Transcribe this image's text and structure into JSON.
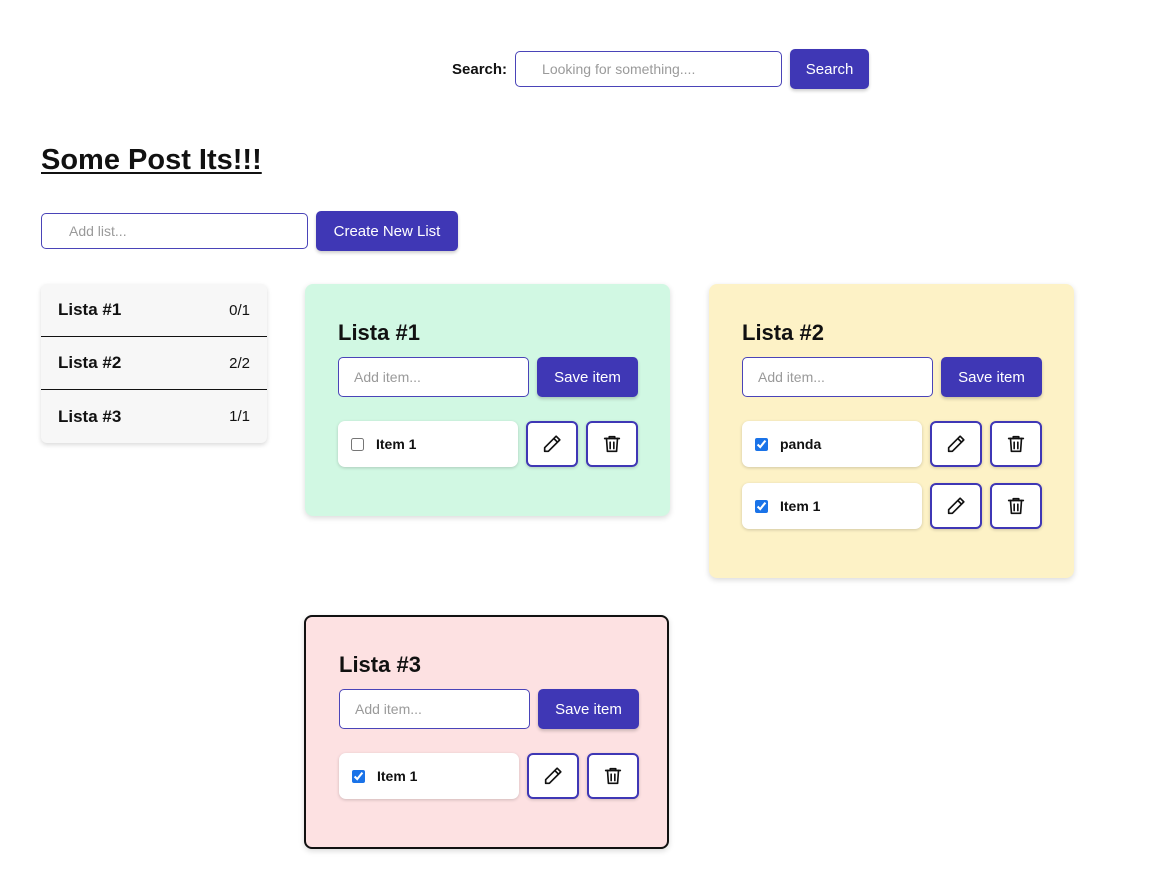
{
  "search": {
    "label": "Search:",
    "placeholder": "Looking for something....",
    "button": "Search"
  },
  "page": {
    "title": "Some Post Its!!!"
  },
  "add_list": {
    "placeholder": "Add list...",
    "button": "Create New List"
  },
  "index": [
    {
      "name": "Lista #1",
      "count": "0/1"
    },
    {
      "name": "Lista #2",
      "count": "2/2"
    },
    {
      "name": "Lista #3",
      "count": "1/1"
    }
  ],
  "cards": [
    {
      "title": "Lista #1",
      "color": "#d1f8e3",
      "placeholder": "Add item...",
      "save": "Save item",
      "items": [
        {
          "text": "Item 1",
          "checked": false
        }
      ]
    },
    {
      "title": "Lista #2",
      "color": "#fdf2c6",
      "placeholder": "Add item...",
      "save": "Save item",
      "items": [
        {
          "text": "panda",
          "checked": true
        },
        {
          "text": "Item 1",
          "checked": true
        }
      ]
    },
    {
      "title": "Lista #3",
      "color": "#fde1e2",
      "placeholder": "Add item...",
      "save": "Save item",
      "items": [
        {
          "text": "Item 1",
          "checked": true
        }
      ]
    }
  ],
  "icons": {
    "edit": "pencil-icon",
    "delete": "trash-icon"
  },
  "colors": {
    "accent": "#3f37b5",
    "checkbox": "#1a73e8"
  }
}
